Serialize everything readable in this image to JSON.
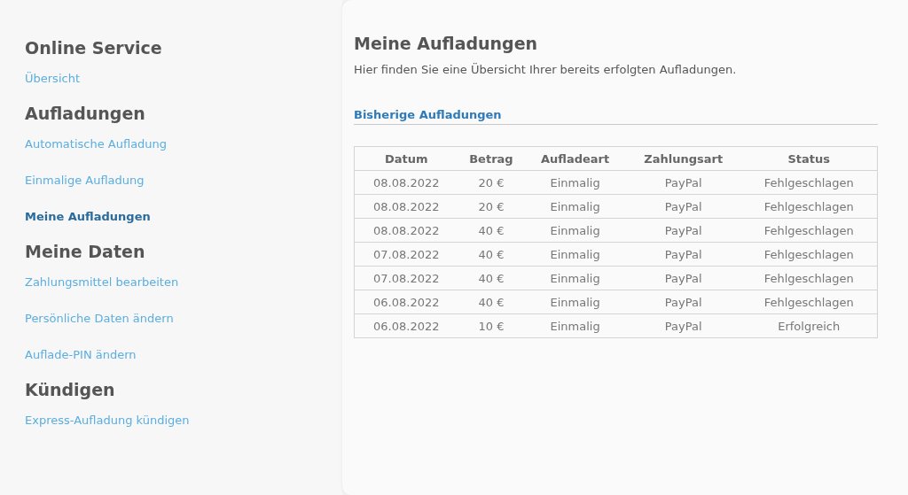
{
  "sidebar": {
    "groups": [
      {
        "heading": "Online Service",
        "items": [
          {
            "label": "Übersicht",
            "selected": false
          }
        ]
      },
      {
        "heading": "Aufladungen",
        "items": [
          {
            "label": "Automatische Aufladung",
            "selected": false
          },
          {
            "label": "Einmalige Aufladung",
            "selected": false
          },
          {
            "label": "Meine Aufladungen",
            "selected": true
          }
        ]
      },
      {
        "heading": "Meine Daten",
        "items": [
          {
            "label": "Zahlungsmittel bearbeiten",
            "selected": false
          },
          {
            "label": "Persönliche Daten ändern",
            "selected": false
          },
          {
            "label": "Auflade-PIN ändern",
            "selected": false
          }
        ]
      },
      {
        "heading": "Kündigen",
        "items": [
          {
            "label": "Express-Aufladung kündigen",
            "selected": false
          }
        ]
      }
    ]
  },
  "main": {
    "title": "Meine Aufladungen",
    "intro": "Hier finden Sie eine Übersicht Ihrer bereits erfolgten Aufladungen.",
    "section_title": "Bisherige Aufladungen",
    "table": {
      "columns": [
        "Datum",
        "Betrag",
        "Aufladeart",
        "Zahlungsart",
        "Status"
      ],
      "rows": [
        [
          "08.08.2022",
          "20 €",
          "Einmalig",
          "PayPal",
          "Fehlgeschlagen"
        ],
        [
          "08.08.2022",
          "20 €",
          "Einmalig",
          "PayPal",
          "Fehlgeschlagen"
        ],
        [
          "08.08.2022",
          "40 €",
          "Einmalig",
          "PayPal",
          "Fehlgeschlagen"
        ],
        [
          "07.08.2022",
          "40 €",
          "Einmalig",
          "PayPal",
          "Fehlgeschlagen"
        ],
        [
          "07.08.2022",
          "40 €",
          "Einmalig",
          "PayPal",
          "Fehlgeschlagen"
        ],
        [
          "06.08.2022",
          "40 €",
          "Einmalig",
          "PayPal",
          "Fehlgeschlagen"
        ],
        [
          "06.08.2022",
          "10 €",
          "Einmalig",
          "PayPal",
          "Erfolgreich"
        ]
      ]
    }
  }
}
